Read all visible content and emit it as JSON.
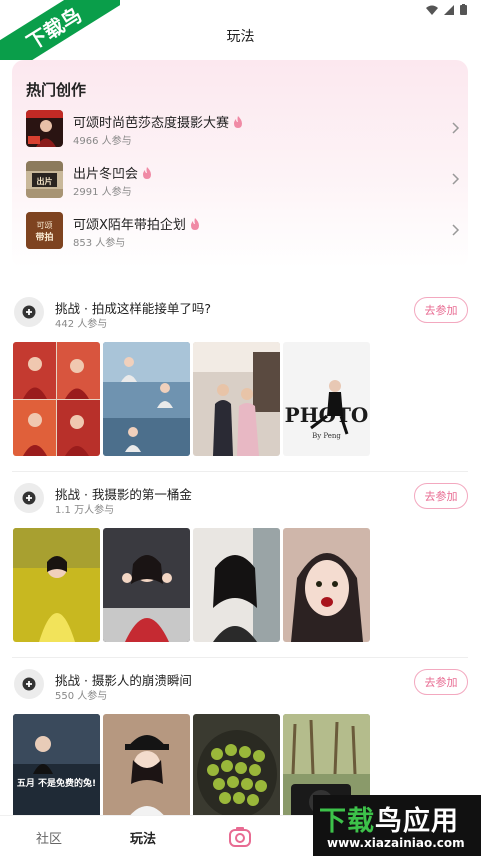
{
  "watermark_top": "下载鸟",
  "header": {
    "title": "玩法"
  },
  "hot": {
    "title": "热门创作",
    "items": [
      {
        "name": "可颂时尚芭莎态度摄影大赛",
        "count": "4966 人参与"
      },
      {
        "name": "出片冬凹会",
        "count": "2991 人参与"
      },
      {
        "name": "可颂X陌年带拍企划",
        "count": "853 人参与"
      }
    ]
  },
  "challenges": [
    {
      "title": "挑战 · 拍成这样能接单了吗?",
      "count": "442 人参与",
      "button": "去参加"
    },
    {
      "title": "挑战 · 我摄影的第一桶金",
      "count": "1.1 万人参与",
      "button": "去参加"
    },
    {
      "title": "挑战 · 摄影人的崩溃瞬间",
      "count": "550 人参与",
      "button": "去参加"
    }
  ],
  "photo_text": {
    "photo_title": "PHOTO",
    "photo_by": "By Peng",
    "meme": "五月 不是免费的兔!"
  },
  "nav": {
    "community": "社区",
    "play": "玩法"
  },
  "watermark_bottom": {
    "main_a": "下载",
    "main_b": "鸟应用",
    "url": "www.xiazainiao.com"
  },
  "colors": {
    "accent": "#e86b92",
    "card_bg": "#fce8ef",
    "watermark_green": "#0a9e4a"
  }
}
